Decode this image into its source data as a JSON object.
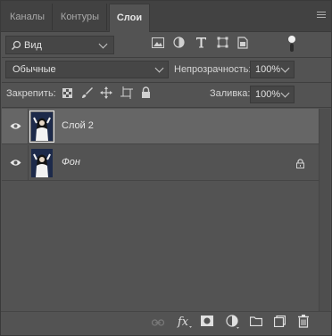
{
  "tabs": [
    {
      "label": "Каналы",
      "active": false
    },
    {
      "label": "Контуры",
      "active": false
    },
    {
      "label": "Слои",
      "active": true
    }
  ],
  "filter": {
    "kind_label": "Вид",
    "icons": [
      "image-filter-icon",
      "adjustment-filter-icon",
      "type-filter-icon",
      "shape-filter-icon",
      "smart-object-filter-icon",
      "filter-toggle-icon"
    ]
  },
  "blend": {
    "mode": "Обычные",
    "opacity_label": "Непрозрачность:",
    "opacity_value": "100%"
  },
  "lock": {
    "label": "Закрепить:",
    "fill_label": "Заливка:",
    "fill_value": "100%",
    "icons": [
      "lock-transparent-icon",
      "lock-pixels-icon",
      "lock-position-icon",
      "lock-artboard-icon",
      "lock-all-icon"
    ]
  },
  "layers": [
    {
      "name": "Слой 2",
      "visible": true,
      "selected": true,
      "locked": false,
      "italic": false
    },
    {
      "name": "Фон",
      "visible": true,
      "selected": false,
      "locked": true,
      "italic": true
    }
  ],
  "bottom_icons": [
    "link-icon",
    "fx-icon",
    "mask-icon",
    "adjustment-icon",
    "folder-icon",
    "new-layer-icon",
    "trash-icon"
  ],
  "colors": {
    "panel_bg": "#535353",
    "selected_layer": "#666666",
    "tabbar_bg": "#424242"
  }
}
